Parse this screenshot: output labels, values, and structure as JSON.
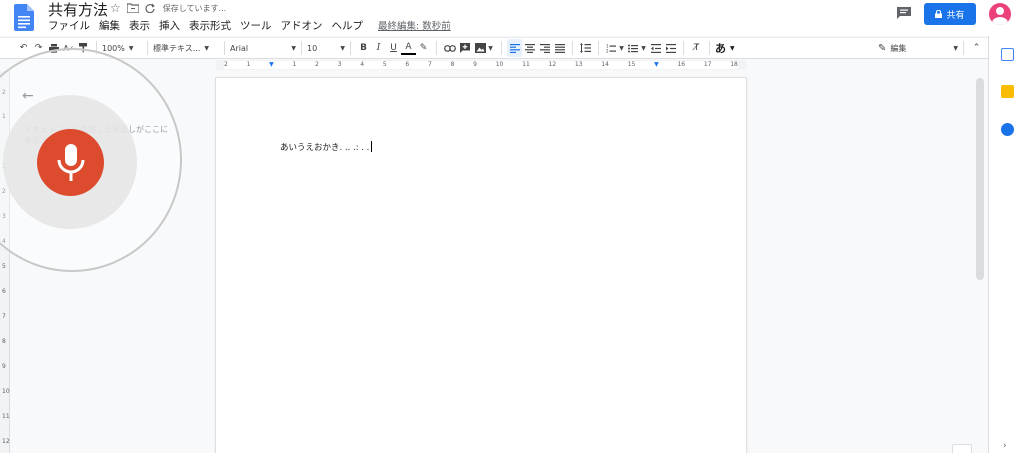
{
  "header": {
    "doc_title": "共有方法",
    "saving_status": "保存しています...",
    "last_edit": "最終編集: 数秒前",
    "share_label": "共有",
    "menu": [
      "ファイル",
      "編集",
      "表示",
      "挿入",
      "表示形式",
      "ツール",
      "アドオン",
      "ヘルプ"
    ]
  },
  "toolbar": {
    "zoom": "100%",
    "style": "標準テキス...",
    "font": "Arial",
    "font_size": "10",
    "input_mode": "あ",
    "edit_mode": "編集"
  },
  "ruler": {
    "ticks": [
      "2",
      "1",
      "1",
      "2",
      "3",
      "4",
      "5",
      "6",
      "7",
      "8",
      "9",
      "10",
      "11",
      "12",
      "13",
      "14",
      "15",
      "16",
      "17",
      "18"
    ],
    "left_ticks": [
      "2",
      "1",
      "1",
      "2",
      "3",
      "4",
      "5",
      "6",
      "7",
      "8",
      "9",
      "10",
      "11",
      "12"
    ]
  },
  "outline": {
    "hint": "ドキュメントに追加した見出しがここに表示されます。"
  },
  "document": {
    "text": "あいうえおかき. .. .: . ."
  },
  "colors": {
    "accent": "#1a73e8",
    "mic": "#dd4b2e",
    "doc_icon": "#4285f4",
    "avatar": "#ec407a"
  }
}
